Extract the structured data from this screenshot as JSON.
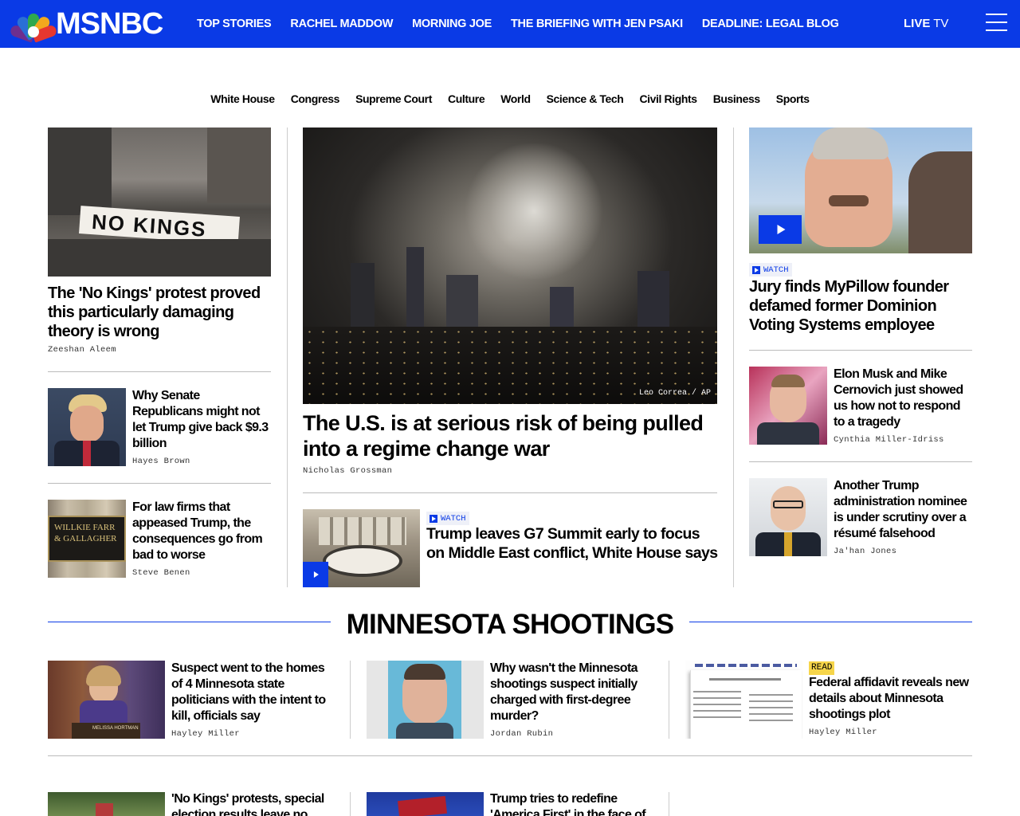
{
  "brand": {
    "name": "MSNBC"
  },
  "nav": {
    "items": [
      "TOP STORIES",
      "RACHEL MADDOW",
      "MORNING JOE",
      "THE BRIEFING WITH JEN PSAKI",
      "DEADLINE: LEGAL BLOG"
    ],
    "live_bold": "LIVE",
    "live_rest": " TV"
  },
  "subnav": [
    "White House",
    "Congress",
    "Supreme Court",
    "Culture",
    "World",
    "Science & Tech",
    "Civil Rights",
    "Business",
    "Sports"
  ],
  "left": {
    "lead": {
      "headline": "The 'No Kings' protest proved this particularly damaging theory is wrong",
      "byline": "Zeeshan Aleem"
    },
    "story2": {
      "headline": "Why Senate Republicans might not let Trump give back $9.3 billion",
      "byline": "Hayes Brown"
    },
    "story3": {
      "headline": "For law firms that appeased Trump, the consequences go from bad to worse",
      "byline": "Steve Benen",
      "sign_text": "WILLKIE FARR & GALLAGHER"
    }
  },
  "center": {
    "lead": {
      "headline": "The U.S. is at serious risk of being pulled into a regime change war",
      "byline": "Nicholas Grossman",
      "credit": "Leo Correa / AP"
    },
    "story2": {
      "badge": "WATCH",
      "headline": "Trump leaves G7 Summit early to focus on Middle East conflict, White House says"
    }
  },
  "right": {
    "lead": {
      "badge": "WATCH",
      "headline": "Jury finds MyPillow founder defamed former Dominion Voting Systems employee"
    },
    "story2": {
      "headline": "Elon Musk and Mike Cernovich just showed us how not to respond to a tragedy",
      "byline": "Cynthia Miller-Idriss"
    },
    "story3": {
      "headline": "Another Trump administration nominee is under scrutiny over a résumé falsehood",
      "byline": "Ja'han Jones"
    }
  },
  "section": {
    "title": "MINNESOTA SHOOTINGS",
    "stories": [
      {
        "headline": "Suspect went to the homes of 4 Minnesota state politicians with the intent to kill, officials say",
        "byline": "Hayley Miller",
        "placard": "MELISSA HORTMAN"
      },
      {
        "headline": "Why wasn't the Minnesota shootings suspect initially charged with first-degree murder?",
        "byline": "Jordan Rubin"
      },
      {
        "badge": "READ",
        "headline": "Federal affidavit reveals new details about Minnesota shootings plot",
        "byline": "Hayley Miller"
      }
    ],
    "more": [
      {
        "headline": "'No Kings' protests, special election results leave no"
      },
      {
        "headline": "Trump tries to redefine 'America First' in the face of"
      }
    ]
  },
  "colors": {
    "brand_blue": "#0a3ae6",
    "read_badge": "#f6d54a"
  }
}
